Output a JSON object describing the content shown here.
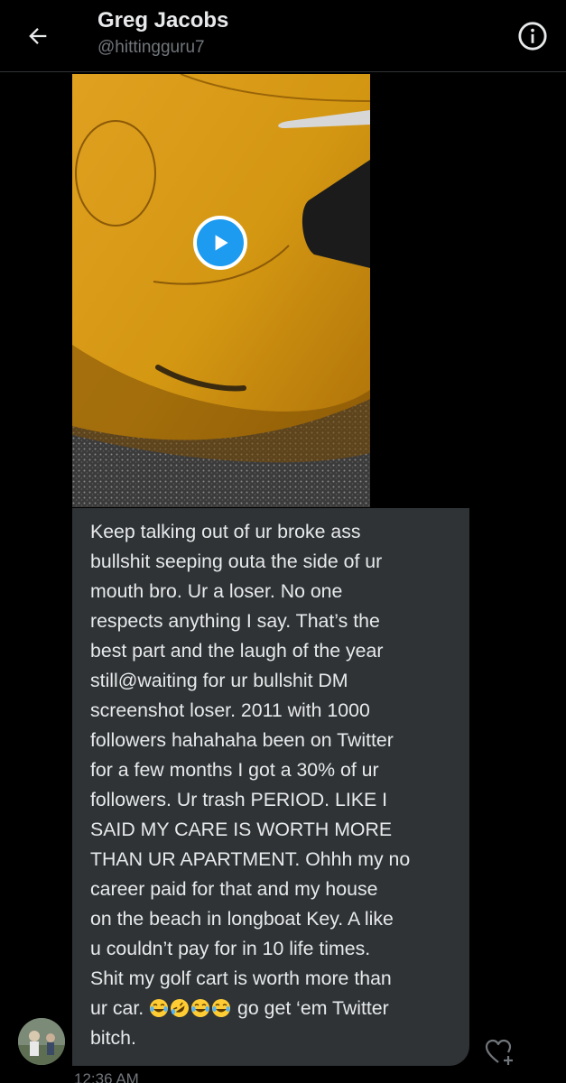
{
  "header": {
    "back_icon": "arrow-left-icon",
    "name": "Greg Jacobs",
    "handle": "@hittingguru7",
    "info_icon": "info-circle-icon"
  },
  "media": {
    "type": "video",
    "play_icon": "play-icon"
  },
  "message": {
    "text": "Keep talking out of ur broke ass\nbullshit seeping outa the side of ur\nmouth bro. Ur a loser. No one\nrespects anything I say. That’s the\nbest part and the laugh of the year\nstill@waiting for ur bullshit DM\nscreenshot loser. 2011 with 1000\nfollowers hahahaha been on Twitter\nfor a few months I got a 30% of ur\nfollowers. Ur trash PERIOD. LIKE I\nSAID MY CARE IS WORTH MORE\nTHAN UR APARTMENT. Ohhh my no\ncareer paid for that and my house\non the beach in longboat Key. A like\nu couldn’t pay for in 10 life times.\nShit my golf cart is worth more than",
    "last_line_before": "ur car. ",
    "emojis": [
      "😂",
      "🤣",
      "😂",
      "😂"
    ],
    "last_line_after": " go get ‘em Twitter\nbitch.",
    "timestamp": "12:36 AM",
    "react_icon": "heart-plus-icon"
  },
  "colors": {
    "background": "#000000",
    "bubble": "#2f3336",
    "text": "#e7e9ea",
    "secondary_text": "#71767b",
    "accent": "#1d9bf0"
  }
}
